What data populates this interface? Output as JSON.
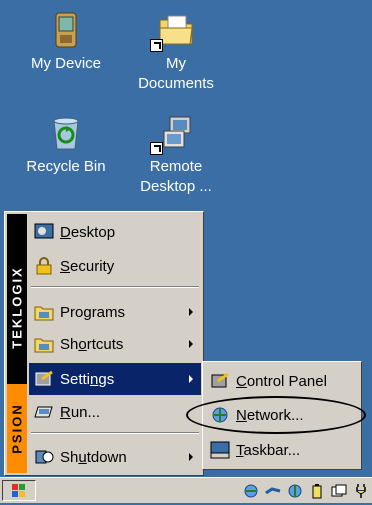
{
  "desktop": {
    "icons": [
      {
        "label": "My Device",
        "icon": "pda-device-icon"
      },
      {
        "label": "My\nDocuments",
        "icon": "folder-icon"
      },
      {
        "label": "Recycle Bin",
        "icon": "recycle-bin-icon"
      },
      {
        "label": "Remote\nDesktop ...",
        "icon": "remote-desktop-icon"
      }
    ]
  },
  "start_menu": {
    "sidebar_brand_top": "TEKLOGIX",
    "sidebar_brand_bottom": "PSION",
    "items": [
      {
        "pre": "",
        "u": "D",
        "post": "esktop",
        "icon": "desktop-icon"
      },
      {
        "pre": "",
        "u": "S",
        "post": "ecurity",
        "icon": "lock-icon"
      },
      {
        "pre": "Pro",
        "u": "g",
        "post": "rams",
        "icon": "programs-folder-icon"
      },
      {
        "pre": "Sh",
        "u": "o",
        "post": "rtcuts",
        "icon": "shortcuts-folder-icon"
      },
      {
        "pre": "Setti",
        "u": "n",
        "post": "gs",
        "icon": "settings-icon"
      },
      {
        "pre": "",
        "u": "R",
        "post": "un...",
        "icon": "run-icon"
      },
      {
        "pre": "Sh",
        "u": "u",
        "post": "tdown",
        "icon": "shutdown-icon"
      }
    ]
  },
  "settings_submenu": {
    "items": [
      {
        "pre": "",
        "u": "C",
        "post": "ontrol Panel",
        "icon": "control-panel-icon"
      },
      {
        "pre": "",
        "u": "N",
        "post": "etwork...",
        "icon": "network-icon"
      },
      {
        "pre": "",
        "u": "T",
        "post": "askbar...",
        "icon": "taskbar-icon"
      }
    ]
  },
  "taskbar": {
    "start_icon": "windows-flag-icon",
    "tray_icons": [
      "network-status-icon",
      "connection-icon",
      "globe-icon",
      "battery-icon",
      "keyboard-icon",
      "power-plug-icon"
    ]
  },
  "colors": {
    "desktop": "#3A6EA5",
    "menu": "#D4D0C8",
    "selection": "#0A246A",
    "brand_orange": "#FF8C00"
  }
}
